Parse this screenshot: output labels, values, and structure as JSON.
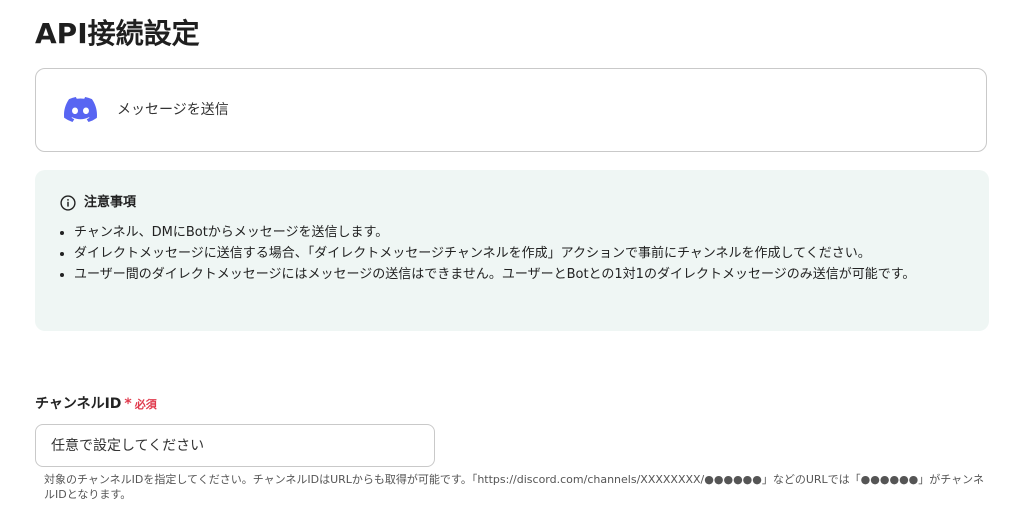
{
  "page": {
    "title": "API接続設定"
  },
  "action": {
    "icon": "discord-icon",
    "label": "メッセージを送信",
    "brand_color": "#5865F2"
  },
  "notice": {
    "icon": "info-icon",
    "title": "注意事項",
    "items": [
      "チャンネル、DMにBotからメッセージを送信します。",
      "ダイレクトメッセージに送信する場合、「ダイレクトメッセージチャンネルを作成」アクションで事前にチャンネルを作成してください。",
      "ユーザー間のダイレクトメッセージにはメッセージの送信はできません。ユーザーとBotとの1対1のダイレクトメッセージのみ送信が可能です。"
    ],
    "background": "#eff6f4"
  },
  "field": {
    "label": "チャンネルID",
    "required_mark": "*",
    "required_text": "必須",
    "placeholder": "任意で設定してください",
    "value": "",
    "help": "対象のチャンネルIDを指定してください。チャンネルIDはURLからも取得が可能です。「https://discord.com/channels/XXXXXXXX/●●●●●●」などのURLでは「●●●●●●」がチャンネルIDとなります。",
    "required_color": "#e0394c"
  }
}
